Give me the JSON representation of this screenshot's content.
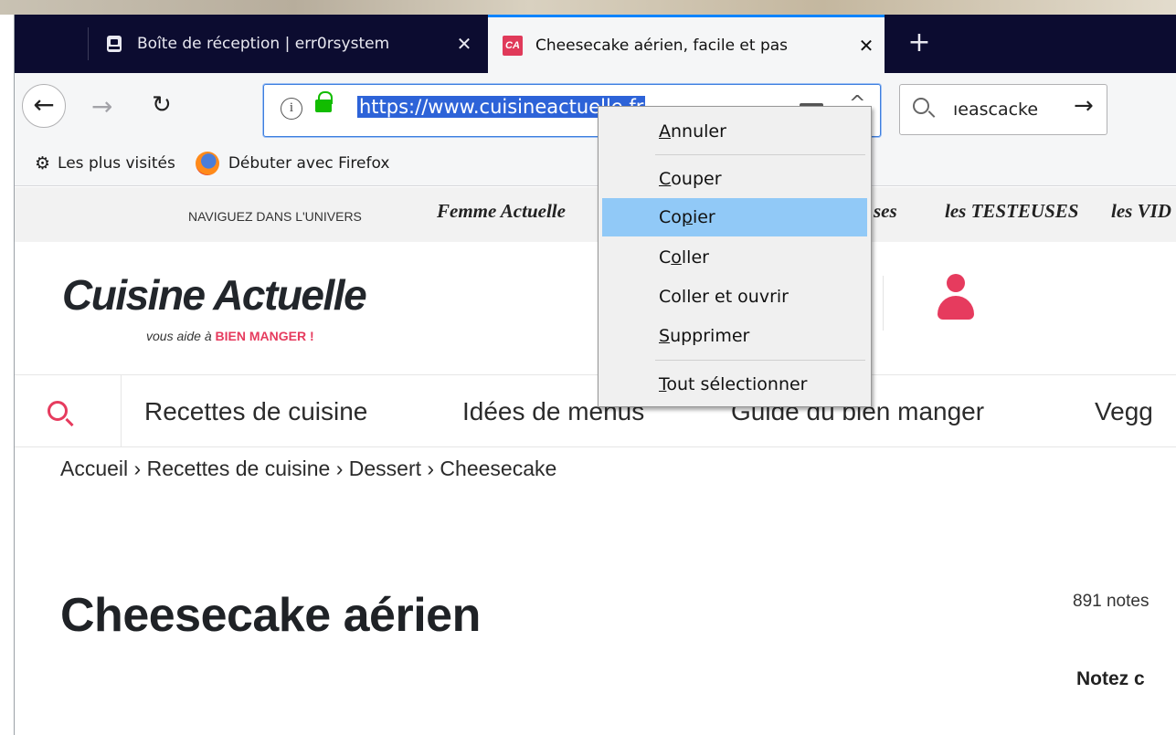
{
  "browser": {
    "tabs": [
      {
        "title": "Boîte de réception | err0rsystem",
        "favicon": "mail-icon"
      },
      {
        "title": "Cheesecake aérien, facile et pas",
        "favicon": "CA",
        "active": true
      }
    ],
    "url": "https://www.cuisineactuelle.fr",
    "search_value": "ıeascacke",
    "bookmarks": [
      {
        "label": "Les plus visités",
        "icon": "gear-icon"
      },
      {
        "label": "Débuter avec Firefox",
        "icon": "firefox-icon"
      }
    ]
  },
  "context_menu": {
    "items": [
      {
        "prefix": "",
        "accel": "A",
        "rest": "nnuler"
      },
      {
        "prefix": "",
        "accel": "C",
        "rest": "ouper"
      },
      {
        "prefix": "Co",
        "accel": "p",
        "rest": "ier"
      },
      {
        "prefix": "C",
        "accel": "o",
        "rest": "ller"
      },
      {
        "prefix": "Co",
        "accel": "l",
        "rest": "ler et ouvrir"
      },
      {
        "prefix": "",
        "accel": "S",
        "rest": "upprimer"
      },
      {
        "prefix": "",
        "accel": "T",
        "rest": "out sélectionner"
      }
    ],
    "highlighted": "Copier"
  },
  "site": {
    "universe_label": "NAVIGUEZ DANS L'UNIVERS",
    "brands": [
      "Femme Actuelle",
      "ses",
      "les TESTEUSES",
      "les VID"
    ],
    "logo": "Cuisine Actuelle",
    "tagline_prefix": "vous aide à ",
    "tagline_highlight": "BIEN MANGER !",
    "nav": [
      "Recettes de cuisine",
      "Idées de menus",
      "Guide du bien manger",
      "Vegg"
    ],
    "breadcrumb": "Accueil › Recettes de cuisine › Dessert › Cheesecake",
    "title": "Cheesecake aérien",
    "notes": "891 notes",
    "rate_label": "Notez c"
  },
  "colors": {
    "accent": "#e63b5e",
    "tabstrip": "#0c0c30",
    "selection": "#2d63d8",
    "menu_highlight": "#91c9f7"
  }
}
